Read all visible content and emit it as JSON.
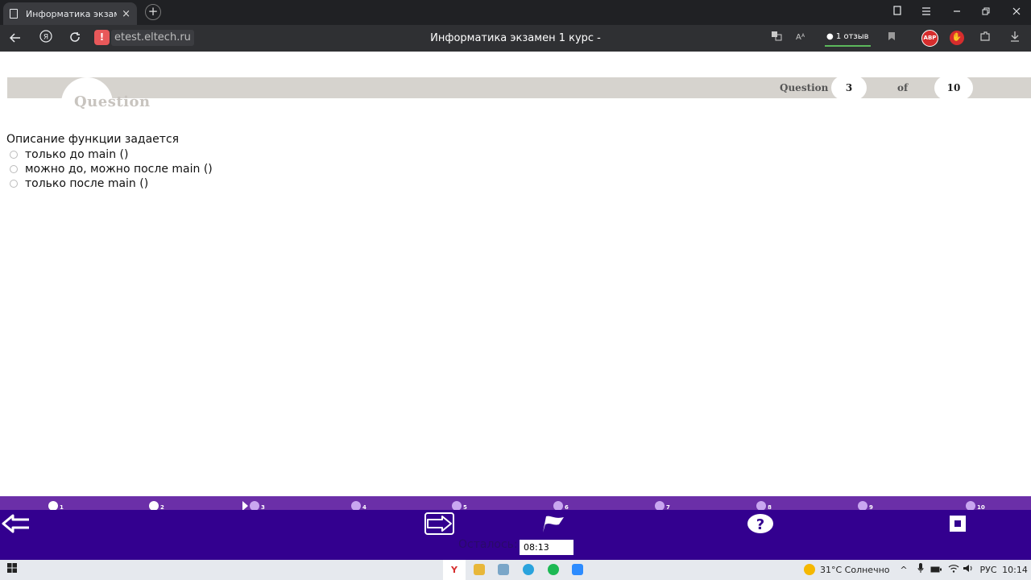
{
  "browser": {
    "tab_title": "Информатика экзамен",
    "tab_close": "×",
    "new_tab": "+",
    "url": "etest.eltech.ru",
    "page_title": "Информатика экзамен 1 курс -",
    "reviews": "1 отзыв",
    "abp_label": "ABP",
    "warning_icon": "warning-icon"
  },
  "test_header": {
    "logo_text": "Question",
    "question_label": "Question",
    "current": "3",
    "of_label": "of",
    "total": "10"
  },
  "question": {
    "text": "Описание функции задается",
    "options": [
      "только до main ()",
      "можно до, можно после main ()",
      "только после main ()"
    ]
  },
  "nav": {
    "items": [
      "1",
      "2",
      "3",
      "4",
      "5",
      "6",
      "7",
      "8",
      "9",
      "10"
    ],
    "current": "3"
  },
  "footer": {
    "remaining_label": "Осталось:",
    "timer": "08:13"
  },
  "taskbar": {
    "weather": "31°C  Солнечно",
    "lang": "РУС",
    "time": "10:14"
  },
  "colors": {
    "nav_strip": "#6b2fa8",
    "toolbar": "#33008f",
    "answered_dot": "#ffffff",
    "unanswered_dot": "#c9a6f0",
    "header_strip": "#d6d3ce"
  }
}
